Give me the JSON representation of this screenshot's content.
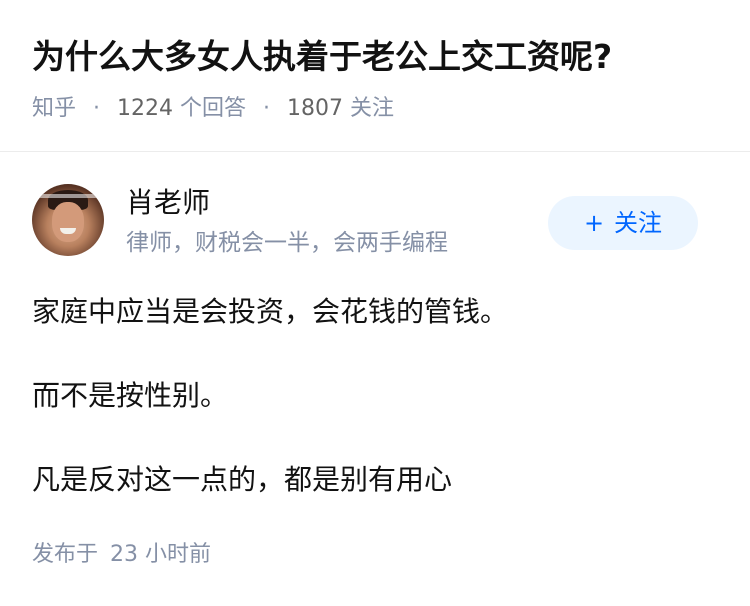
{
  "question": {
    "title": "为什么大多女人执着于老公上交工资呢?",
    "source": "知乎",
    "answer_count": "1224",
    "answer_label": "个回答",
    "follower_count": "1807",
    "follower_label": "关注",
    "separator": "·"
  },
  "author": {
    "name": "肖老师",
    "bio": "律师，财税会一半，会两手编程",
    "avatar_icon": "avatar-photo",
    "follow_plus": "+",
    "follow_label": "关注"
  },
  "answer": {
    "paragraphs": [
      "家庭中应当是会投资，会花钱的管钱。",
      "而不是按性别。",
      "凡是反对这一点的，都是别有用心"
    ],
    "published_label": "发布于",
    "published_time": "23 小时前"
  },
  "colors": {
    "text": "#121212",
    "muted": "#8590a6",
    "accent": "#0066ff",
    "button_bg": "#ebf5ff"
  }
}
